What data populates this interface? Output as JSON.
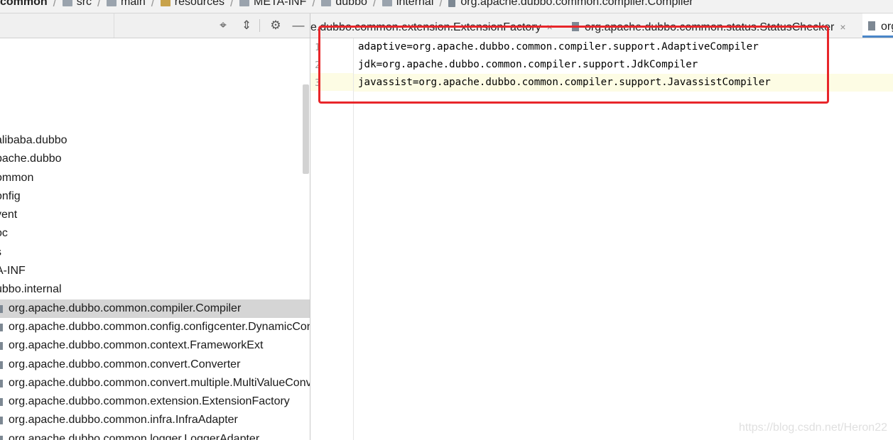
{
  "breadcrumb": [
    {
      "label": "common",
      "icon": "none",
      "root": true
    },
    {
      "label": "src",
      "icon": "folder-icon"
    },
    {
      "label": "main",
      "icon": "folder-icon"
    },
    {
      "label": "resources",
      "icon": "resources-folder-icon"
    },
    {
      "label": "META-INF",
      "icon": "folder-icon"
    },
    {
      "label": "dubbo",
      "icon": "folder-icon"
    },
    {
      "label": "internal",
      "icon": "folder-icon"
    },
    {
      "label": "org.apache.dubbo.common.compiler.Compiler",
      "icon": "file-icon"
    }
  ],
  "toolbar": {
    "locate_icon": "⌖",
    "collapse_icon": "⇕",
    "settings_icon": "⚙",
    "hide_icon": "—"
  },
  "tree": [
    {
      "label": "alibaba.dubbo",
      "type": "folder"
    },
    {
      "label": "pache.dubbo",
      "type": "folder"
    },
    {
      "label": "ommon",
      "type": "folder"
    },
    {
      "label": "onfig",
      "type": "folder"
    },
    {
      "label": "vent",
      "type": "folder"
    },
    {
      "label": "oc",
      "type": "folder"
    },
    {
      "label": "s",
      "type": "folder"
    },
    {
      "label": "A-INF",
      "type": "folder"
    },
    {
      "label": "ubbo.internal",
      "type": "folder"
    },
    {
      "label": "org.apache.dubbo.common.compiler.Compiler",
      "type": "file",
      "selected": true
    },
    {
      "label": "org.apache.dubbo.common.config.configcenter.DynamicConfigurationFactory",
      "type": "file"
    },
    {
      "label": "org.apache.dubbo.common.context.FrameworkExt",
      "type": "file"
    },
    {
      "label": "org.apache.dubbo.common.convert.Converter",
      "type": "file"
    },
    {
      "label": "org.apache.dubbo.common.convert.multiple.MultiValueConverter",
      "type": "file"
    },
    {
      "label": "org.apache.dubbo.common.extension.ExtensionFactory",
      "type": "file"
    },
    {
      "label": "org.apache.dubbo.common.infra.InfraAdapter",
      "type": "file"
    },
    {
      "label": "org.apache.dubbo.common.logger.LoggerAdapter",
      "type": "file"
    }
  ],
  "tabs": [
    {
      "label": "e.dubbo.common.extension.ExtensionFactory",
      "close": "×"
    },
    {
      "label": "org.apache.dubbo.common.status.StatusChecker",
      "close": "×"
    },
    {
      "label": "org",
      "close": ""
    }
  ],
  "editor": {
    "line_numbers": [
      "1",
      "2",
      "3"
    ],
    "lines": [
      "adaptive=org.apache.dubbo.common.compiler.support.AdaptiveCompiler",
      "jdk=org.apache.dubbo.common.compiler.support.JdkCompiler",
      "javassist=org.apache.dubbo.common.compiler.support.JavassistCompiler"
    ],
    "current_line": 3
  },
  "colors": {
    "annotation": "#e8262a",
    "selection": "#d5d5d5",
    "current_line": "#fdfce4"
  },
  "watermark": "https://blog.csdn.net/Heron22"
}
